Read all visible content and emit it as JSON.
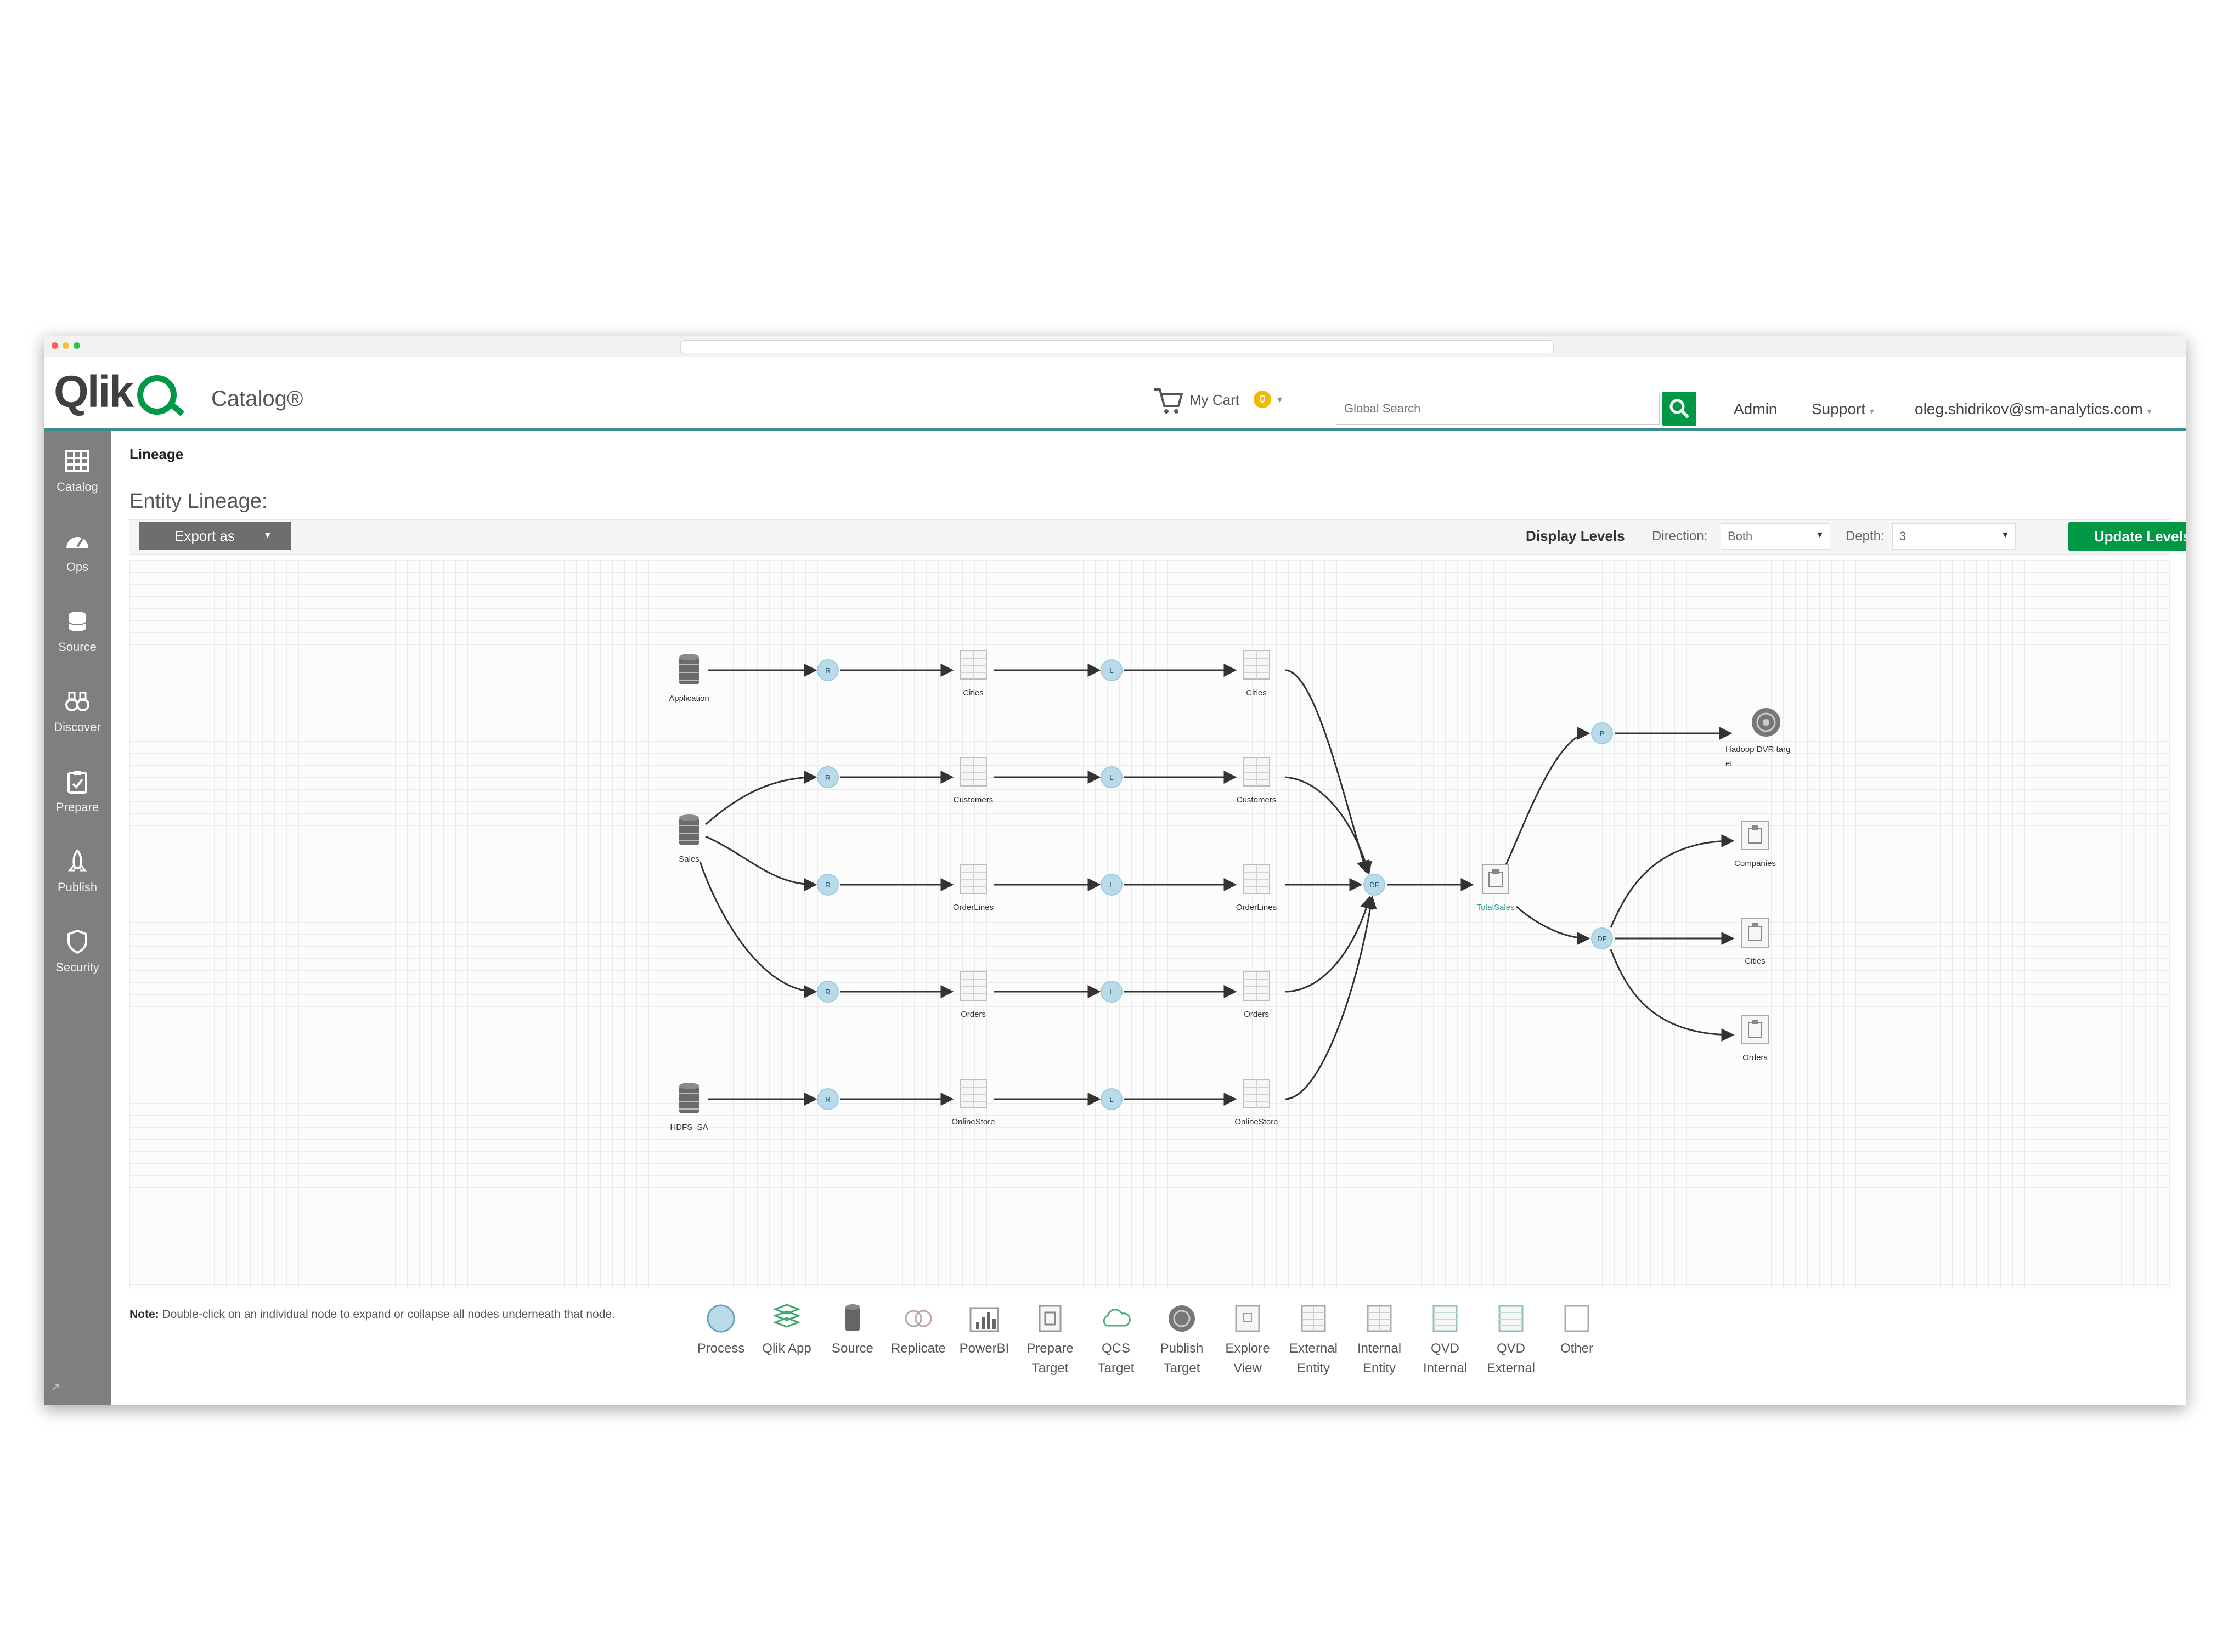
{
  "app": {
    "logo_text": "Qlik",
    "name": "Catalog®"
  },
  "header": {
    "cart_label": "My Cart",
    "cart_count": "0",
    "search_placeholder": "Global Search",
    "admin": "Admin",
    "support": "Support",
    "user": "oleg.shidrikov@sm-analytics.com"
  },
  "sidebar": {
    "items": [
      {
        "label": "Catalog",
        "icon": "grid-icon"
      },
      {
        "label": "Ops",
        "icon": "gauge-icon"
      },
      {
        "label": "Source",
        "icon": "database-icon"
      },
      {
        "label": "Discover",
        "icon": "binoculars-icon"
      },
      {
        "label": "Prepare",
        "icon": "clipboard-icon"
      },
      {
        "label": "Publish",
        "icon": "rocket-icon"
      },
      {
        "label": "Security",
        "icon": "shield-icon"
      }
    ]
  },
  "page": {
    "breadcrumb": "Lineage",
    "title": "Entity Lineage:"
  },
  "toolbar": {
    "export_label": "Export as",
    "display_levels": "Display Levels",
    "direction_label": "Direction:",
    "direction_value": "Both",
    "depth_label": "Depth:",
    "depth_value": "3",
    "update_label": "Update Levels"
  },
  "lineage": {
    "sources": [
      "Application",
      "Sales",
      "HDFS_SA"
    ],
    "tables": [
      "Cities",
      "Customers",
      "OrderLines",
      "Orders",
      "OnlineStore"
    ],
    "process_labels": {
      "ingest": "R",
      "load": "L",
      "prepare": "DF",
      "publish": "P"
    },
    "target": "TotalSales",
    "publish_target": "Hadoop DVR targ et",
    "outputs": [
      "Companies",
      "Cities",
      "Orders"
    ]
  },
  "footer": {
    "note_bold": "Note:",
    "note_text": "Double-click on an individual node to expand or collapse all nodes underneath that node."
  },
  "legend": [
    {
      "line1": "Process",
      "line2": "",
      "icon": "process-icon"
    },
    {
      "line1": "Qlik App",
      "line2": "",
      "icon": "qlik-app-icon"
    },
    {
      "line1": "Source",
      "line2": "",
      "icon": "source-icon"
    },
    {
      "line1": "Replicate",
      "line2": "",
      "icon": "replicate-icon"
    },
    {
      "line1": "PowerBI",
      "line2": "",
      "icon": "powerbi-icon"
    },
    {
      "line1": "Prepare",
      "line2": "Target",
      "icon": "prepare-target-icon"
    },
    {
      "line1": "QCS",
      "line2": "Target",
      "icon": "qcs-target-icon"
    },
    {
      "line1": "Publish",
      "line2": "Target",
      "icon": "publish-target-icon"
    },
    {
      "line1": "Explore",
      "line2": "View",
      "icon": "explore-view-icon"
    },
    {
      "line1": "External",
      "line2": "Entity",
      "icon": "external-entity-icon"
    },
    {
      "line1": "Internal",
      "line2": "Entity",
      "icon": "internal-entity-icon"
    },
    {
      "line1": "QVD",
      "line2": "Internal",
      "icon": "qvd-internal-icon"
    },
    {
      "line1": "QVD",
      "line2": "External",
      "icon": "qvd-external-icon"
    },
    {
      "line1": "Other",
      "line2": "",
      "icon": "other-icon"
    }
  ],
  "colors": {
    "brand_green": "#009845",
    "header_rule": "#3a8d8d",
    "process_node": "#b9dbe9",
    "sidebar": "#7f7f7f"
  }
}
